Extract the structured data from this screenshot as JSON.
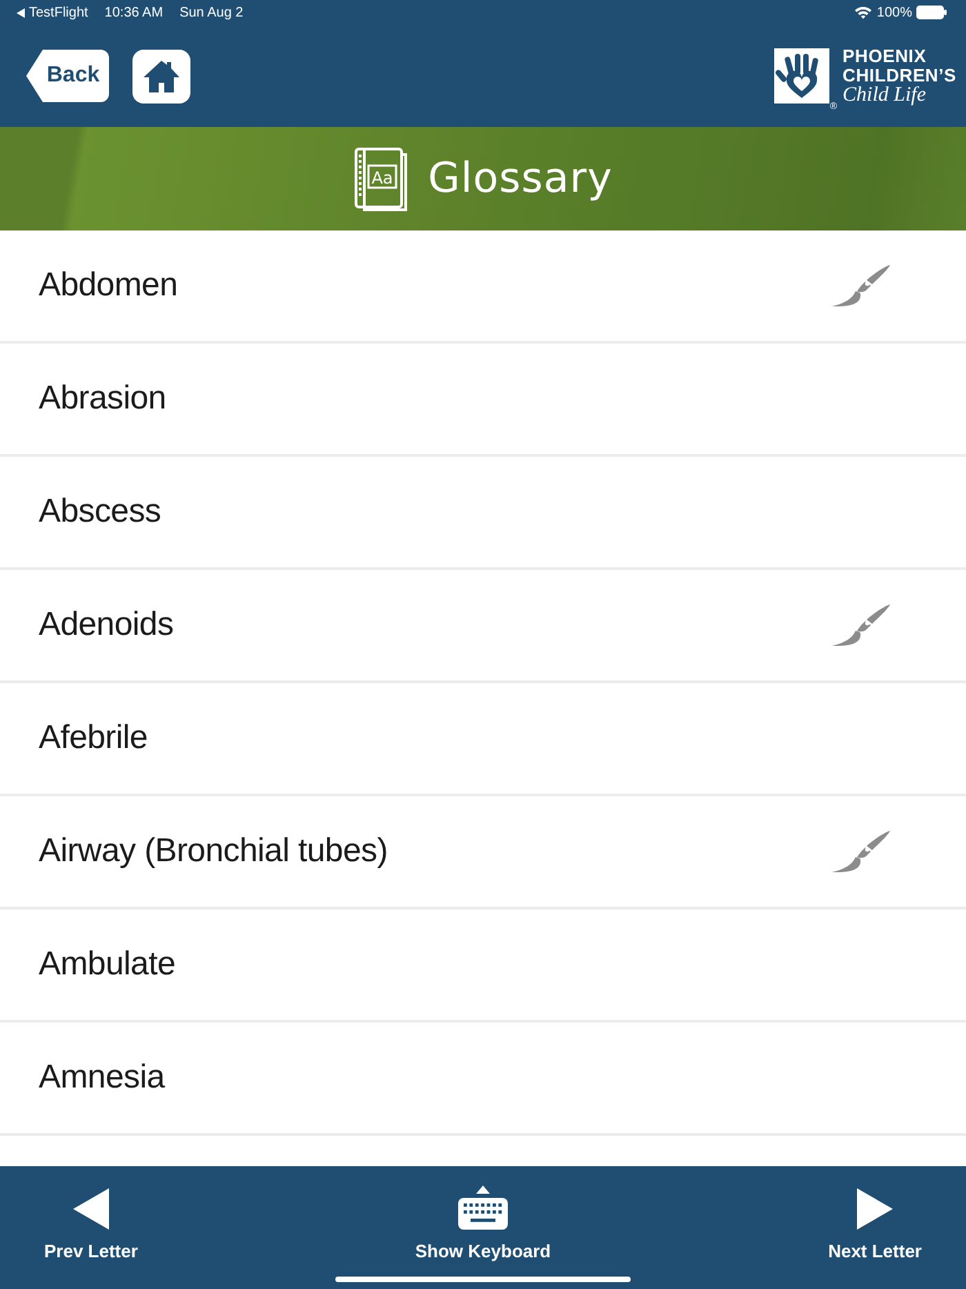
{
  "status_bar": {
    "back_app": "TestFlight",
    "time": "10:36 AM",
    "date": "Sun Aug 2",
    "battery": "100%"
  },
  "nav": {
    "back_button": "Back",
    "logo": {
      "line_1": "PHOENIX",
      "line_2": "CHILDREN’S",
      "line_3": "Child Life",
      "mark": "®"
    }
  },
  "banner": {
    "icon_text": "Aa",
    "title": "Glossary"
  },
  "terms": [
    {
      "label": "Abdomen",
      "has_drawing": true
    },
    {
      "label": "Abrasion",
      "has_drawing": false
    },
    {
      "label": "Abscess",
      "has_drawing": false
    },
    {
      "label": "Adenoids",
      "has_drawing": true
    },
    {
      "label": "Afebrile",
      "has_drawing": false
    },
    {
      "label": "Airway (Bronchial tubes)",
      "has_drawing": true
    },
    {
      "label": "Ambulate",
      "has_drawing": false
    },
    {
      "label": "Amnesia",
      "has_drawing": false
    }
  ],
  "bottom_bar": {
    "buttons": [
      {
        "kind": "prev",
        "label": "Prev Letter"
      },
      {
        "kind": "keyboard",
        "label": "Show Keyboard"
      },
      {
        "kind": "next",
        "label": "Next Letter"
      }
    ]
  }
}
